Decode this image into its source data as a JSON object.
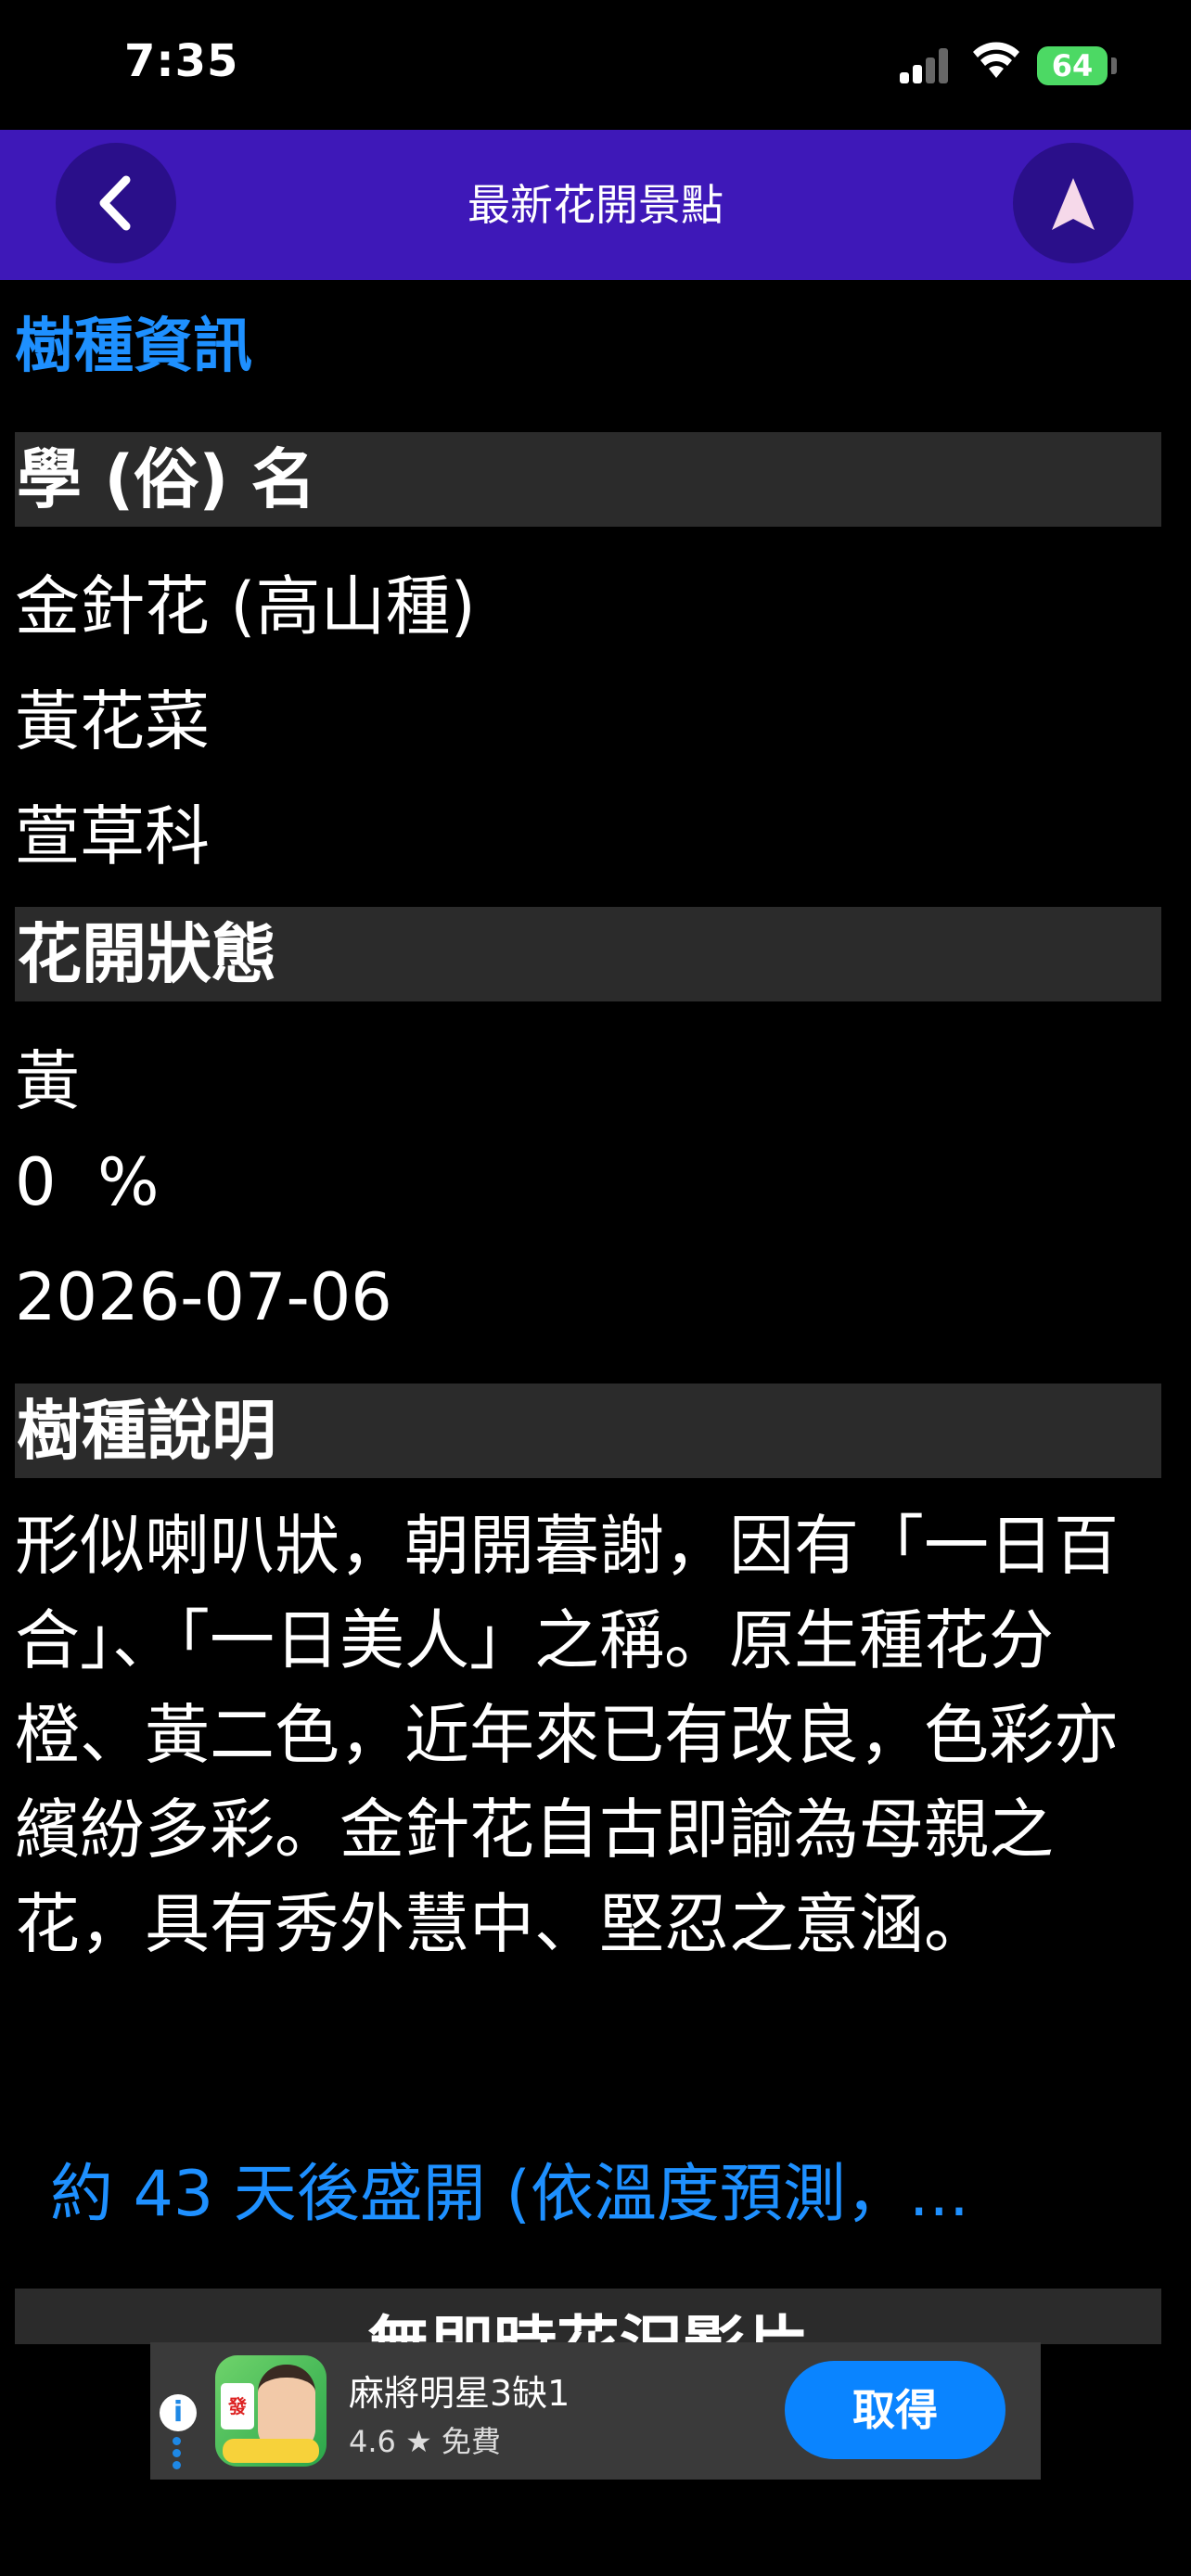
{
  "status_bar": {
    "time": "7:35",
    "battery": "64"
  },
  "nav": {
    "title": "最新花開景點",
    "icons": [
      "chevron-left-icon",
      "location-arrow-icon"
    ]
  },
  "content": {
    "section_title": "樹種資訊",
    "name_header": "學 (俗) 名",
    "scientific_name": "金針花 (高山種)",
    "common_name": "黃花菜",
    "family": "萱草科",
    "bloom_header": "花開狀態",
    "bloom_color": "黃",
    "bloom_percent": "0  %",
    "bloom_date": "2026-07-06",
    "description_header": "樹種說明",
    "description": "形似喇叭狀，朝開暮謝，因有「一日百合」、「一日美人」之稱。原生種花分橙、黃二色，近年來已有改良，色彩亦繽紛多彩。金針花自古即諭為母親之花，具有秀外慧中、堅忍之意涵。",
    "forecast": "約 43 天後盛開 (依溫度預測，...",
    "photo_header": "無即時花況影片"
  },
  "ad": {
    "app_name": "麻將明星3缺1",
    "rating": "4.6 ★  免費",
    "get_label": "取得",
    "icon_tile": "發"
  },
  "colors": {
    "nav_bg": "#3e18b8",
    "accent_blue": "#1e90ff",
    "band_bg": "#2b2b2b",
    "battery_green": "#4cd964",
    "ad_button": "#0a84ff"
  }
}
